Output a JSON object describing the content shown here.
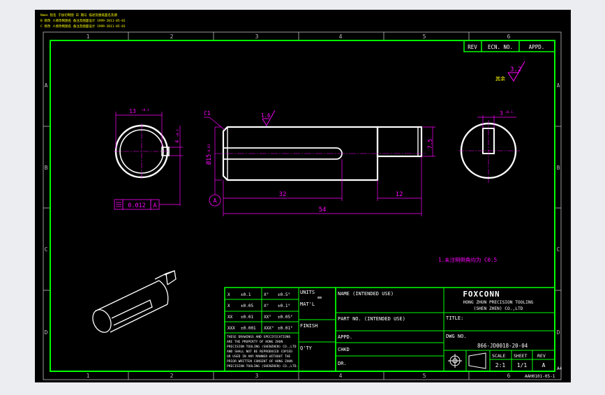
{
  "colors": {
    "outer_bg": "#ecedf0",
    "canvas": "#000000",
    "frame": "#00ff00",
    "geometry": "#ffffff",
    "dimension": "#ff00ff",
    "note": "#ffff00",
    "ticks": "#bfbfbf"
  },
  "header_notes": [
    "Name 程名 于加切制图 日 期与 描述及图纸面名及期",
    "B 修改 人修改制图名 备注及图面设计 1999-2011-05-01",
    "C 修改 人修改制图名 备注及图面设计 1999-2011-05-01"
  ],
  "grid": {
    "columns": [
      "1",
      "2",
      "3",
      "4",
      "5",
      "6"
    ],
    "rows": [
      "A",
      "B",
      "C",
      "D"
    ]
  },
  "rev_table": {
    "rev": "REV",
    "ecn": "ECN. NO.",
    "appd": "APPD."
  },
  "roughness": {
    "symbol_text": "其余",
    "value": "3.2"
  },
  "dims": {
    "d13": "13",
    "d13_tol": "+0.1",
    "d4": "4",
    "d4_tol": "+0.1",
    "c1": "C1",
    "r16": "1.6",
    "d15": "Ø15",
    "d15_tol": "-0.01",
    "d75": "7.5",
    "d32": "32",
    "d12": "12",
    "d54": "54",
    "d3": "3",
    "d3_tol": "+0.1",
    "datum_a": "A",
    "gtol_value": "0.012",
    "gtol_datum": "A"
  },
  "tech_note": "1.未注明倒角均为 C0.5",
  "tolerance_table": {
    "rows": [
      {
        "lin": "X",
        "lin_tol": "±0.1",
        "ang": "X°",
        "ang_tol": "±0.5°"
      },
      {
        "lin": "X",
        "lin_tol": "±0.05",
        "ang": "X°",
        "ang_tol": "±0.1°"
      },
      {
        "lin": "XX",
        "lin_tol": "±0.01",
        "ang": "XX°",
        "ang_tol": "±0.05°"
      },
      {
        "lin": "XXX",
        "lin_tol": "±0.001",
        "ang": "XXX°",
        "ang_tol": "±0.01°"
      }
    ],
    "notice": [
      "THESE DRAWINGS AND SPECIFICATIONS",
      "ARE THE PROPERTY OF HONG ZHUN",
      "PRECISION TOOLING (SHENZHEN) CO.,LTD",
      "AND SHALL NOT BE REPRODUCED COPIED",
      "OR USED IN ANY MANNER WITHOUT THE",
      "PRIOR WRITTEN CONSENT OF HONG ZHUN",
      "PRECISION TOOLING (SHENZHEN) CO.,LTD."
    ],
    "units_label": "UNITS",
    "units_value": "mm",
    "matl_label": "MAT'L",
    "finish_label": "FINISH",
    "qty_label": "Q'TY"
  },
  "title_block": {
    "name_label": "NAME (INTENDED USE)",
    "part_no_label": "PART NO. (INTENDED USE)",
    "appd_label": "APPD.",
    "chkd_label": "CHKD",
    "dr_label": "DR.",
    "logo": "FOXCONN",
    "company_line1": "HONG ZHUN PRECISION TOOLING",
    "company_line2": "(SHEN ZHEN) CO.,LTD",
    "title_label": "TITLE:",
    "dwg_label": "DWG NO.",
    "dwg_no": "866-JD0018-20-04",
    "scale_label": "SCALE",
    "scale_value": "2:1",
    "sheet_label": "SHEET",
    "sheet_value": "1/1",
    "rev_label": "REV",
    "rev_value": "A"
  },
  "form_code": "AAH0101-05-1",
  "form_size": "A4"
}
